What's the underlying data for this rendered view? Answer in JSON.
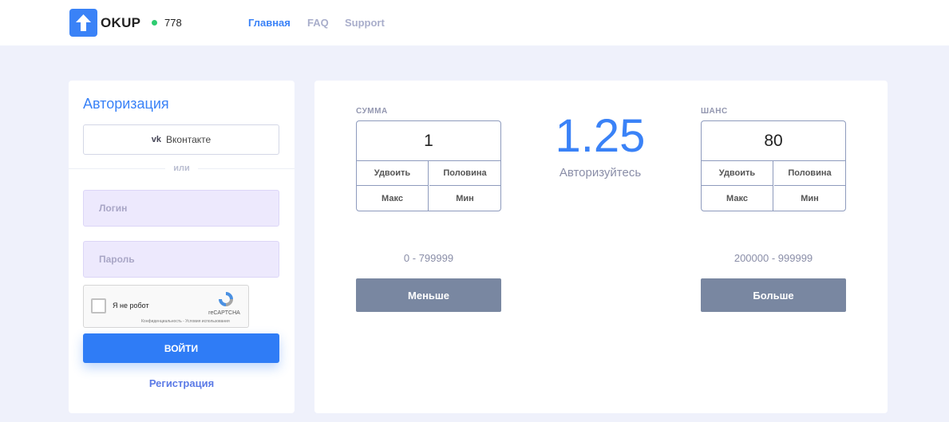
{
  "header": {
    "logo_text": "OKUP",
    "online_count": "778",
    "nav": [
      "Главная",
      "FAQ",
      "Support"
    ]
  },
  "auth": {
    "title": "Авторизация",
    "vk_label": "Вконтакте",
    "vk_icon": "vk",
    "or_label": "или",
    "login_placeholder": "Логин",
    "password_placeholder": "Пароль",
    "captcha_label": "Я не робот",
    "captcha_brand": "reCAPTCHA",
    "captcha_terms": "Конфиденциальность - Условия использования",
    "submit_label": "ВОЙТИ",
    "register_label": "Регистрация"
  },
  "game": {
    "sum": {
      "label": "СУММА",
      "value": "1",
      "buttons": [
        "Удвоить",
        "Половина",
        "Макс",
        "Мин"
      ],
      "range": "0 - 799999",
      "action": "Меньше"
    },
    "coefficient": "1.25",
    "status": "Авторизуйтесь",
    "chance": {
      "label": "ШАНС",
      "value": "80",
      "buttons": [
        "Удвоить",
        "Половина",
        "Макс",
        "Мин"
      ],
      "range": "200000 - 999999",
      "action": "Больше"
    }
  },
  "colors": {
    "accent": "#3a82f7",
    "online": "#2ecc71",
    "action_button": "#7987a1"
  }
}
